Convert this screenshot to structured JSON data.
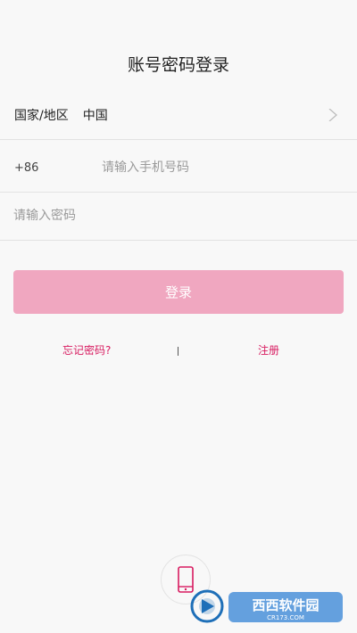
{
  "title": "账号密码登录",
  "region": {
    "label": "国家/地区",
    "value": "中国"
  },
  "phone": {
    "country_code": "+86",
    "placeholder": "请输入手机号码"
  },
  "password": {
    "placeholder": "请输入密码"
  },
  "login_button": "登录",
  "links": {
    "forgot": "忘记密码?",
    "separator": "|",
    "register": "注册"
  },
  "colors": {
    "accent": "#d81b60",
    "button": "#f0a7c0",
    "background": "#f8f8f8"
  },
  "footer_icon": "mobile-phone-icon",
  "watermark": {
    "brand": "西西软件园",
    "site": "CR173.COM"
  }
}
